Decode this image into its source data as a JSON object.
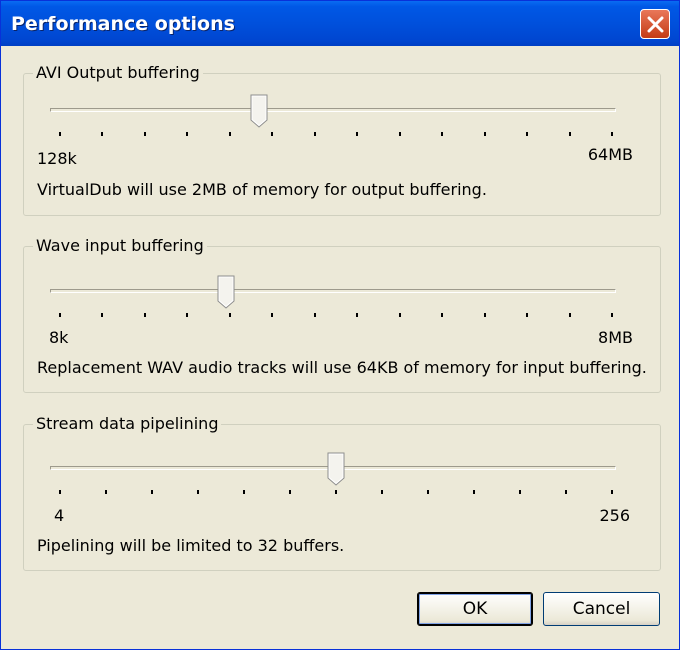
{
  "window": {
    "title": "Performance options"
  },
  "groups": [
    {
      "label": "AVI Output buffering",
      "min_label": "128k",
      "max_label": "64MB",
      "description": "VirtualDub will use 2MB of memory for output buffering.",
      "slider_fraction": 0.36
    },
    {
      "label": "Wave input buffering",
      "min_label": "8k",
      "max_label": "8MB",
      "description": "Replacement WAV audio tracks will use 64KB of memory for input buffering.",
      "slider_fraction": 0.3
    },
    {
      "label": "Stream data pipelining",
      "min_label": "4",
      "max_label": "256",
      "description": "Pipelining will be limited to 32 buffers.",
      "slider_fraction": 0.5
    }
  ],
  "buttons": {
    "ok": "OK",
    "cancel": "Cancel"
  },
  "colors": {
    "titlebar": "#0054e3",
    "face": "#ece9d8",
    "close": "#d94a24"
  },
  "icons": {
    "close": "close-icon",
    "thumb": "slider-thumb"
  }
}
